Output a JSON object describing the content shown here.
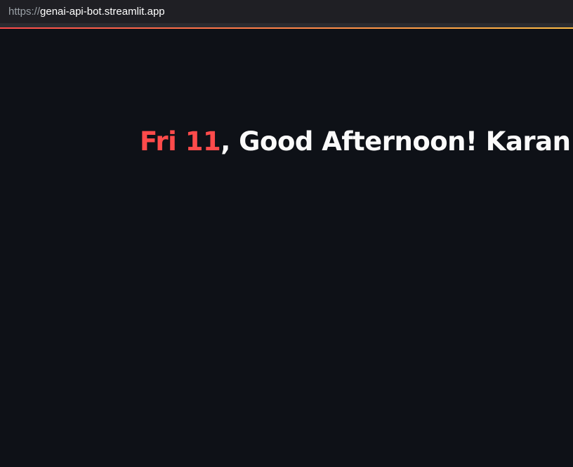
{
  "browser": {
    "url_scheme": "https://",
    "url_host": "genai-api-bot.streamlit.app"
  },
  "main": {
    "greeting": {
      "date": "Fri 11",
      "separator": ",",
      "message": " Good Afternoon! Karan"
    }
  },
  "colors": {
    "background": "#0e1117",
    "accent": "#ff4b4b",
    "text": "#fafafa",
    "decoration_gradient_end": "#ffbd45"
  }
}
